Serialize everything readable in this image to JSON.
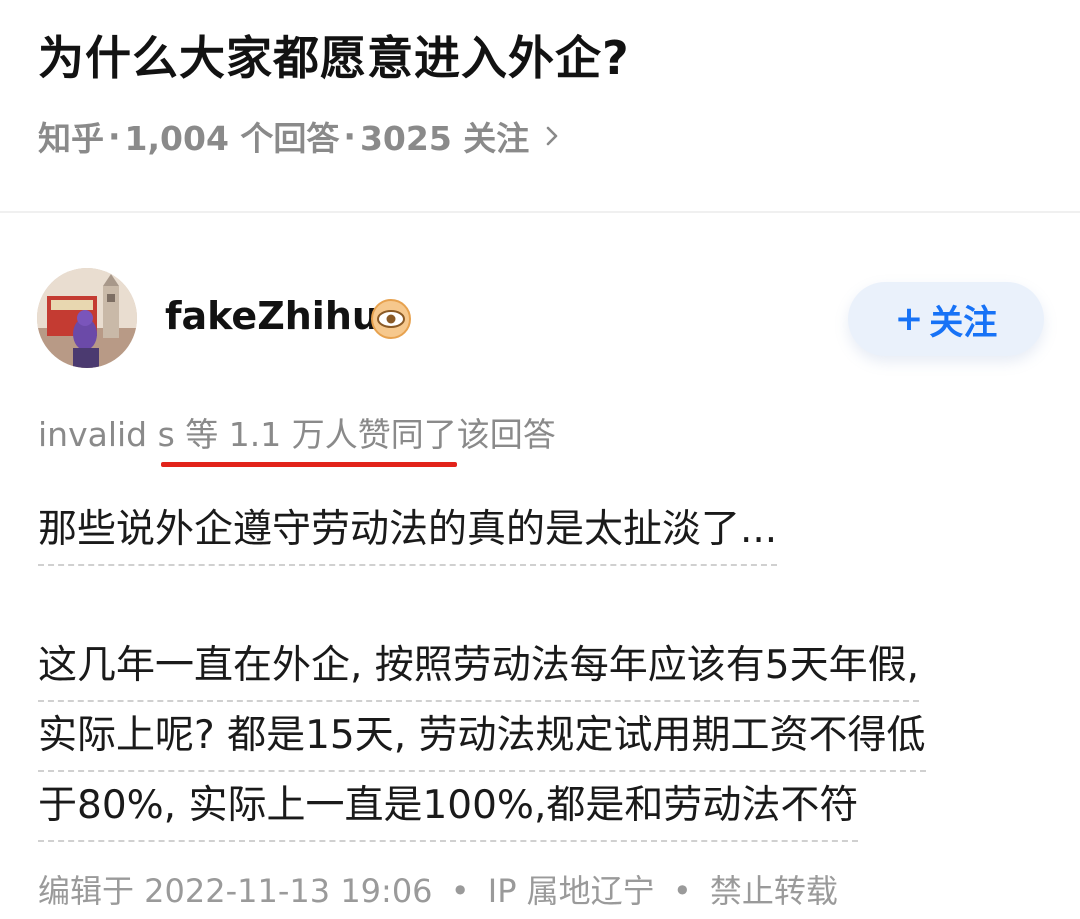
{
  "question": {
    "title": "为什么大家都愿意进入外企?",
    "source": "知乎",
    "answers": "1,004 个回答",
    "followers": "3025 关注",
    "separator": "·",
    "chevron_icon": "chevron-right-icon"
  },
  "author": {
    "name": "fakeZhihu",
    "badge_icon": "eye-badge-icon",
    "avatar_icon": "avatar-image",
    "follow_plus": "+",
    "follow_label": "关注"
  },
  "voters": {
    "text": "invalid s 等 1.1 万人赞同了该回答"
  },
  "answer": {
    "lines": [
      "那些说外企遵守劳动法的真的是太扯淡了...",
      "这几年一直在外企, 按照劳动法每年应该有5天年假,",
      "实际上呢? 都是15天, 劳动法规定试用期工资不得低",
      "于80%, 实际上一直是100%,都是和劳动法不符"
    ]
  },
  "footer": {
    "edited": "编辑于 2022-11-13 19:06",
    "dot": "•",
    "ip": "IP 属地辽宁",
    "rights": "禁止转载"
  },
  "colors": {
    "accent": "#1772f6",
    "underline": "#e2231a",
    "meta_gray": "#8a8a8a"
  }
}
